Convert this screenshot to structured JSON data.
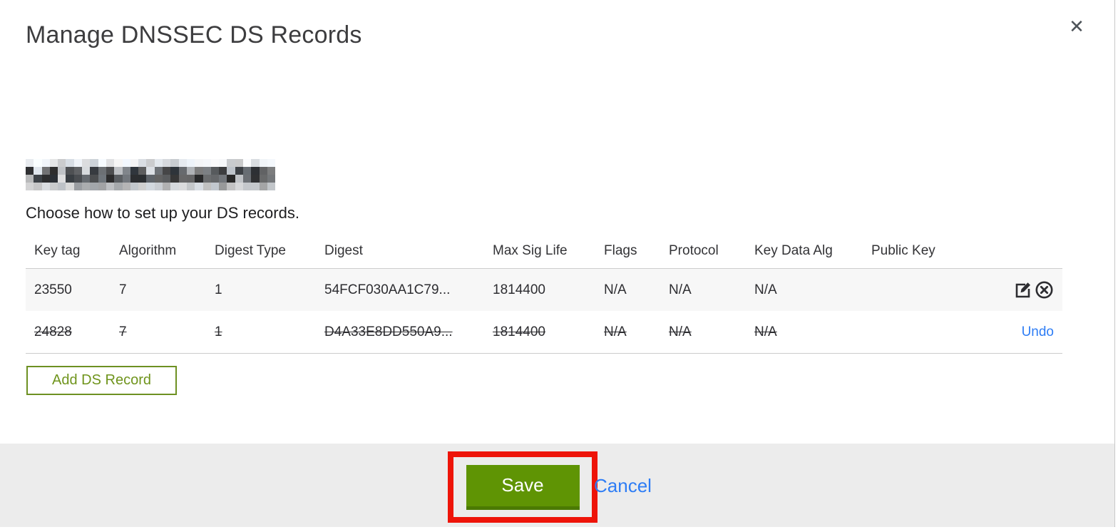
{
  "modal": {
    "title": "Manage DNSSEC DS Records",
    "close_glyph": "✕",
    "instruction": "Choose how to set up your DS records."
  },
  "table": {
    "headers": [
      "Key tag",
      "Algorithm",
      "Digest Type",
      "Digest",
      "Max Sig Life",
      "Flags",
      "Protocol",
      "Key Data Alg",
      "Public Key"
    ],
    "rows": [
      {
        "key_tag": "23550",
        "algorithm": "7",
        "digest_type": "1",
        "digest": "54FCF030AA1C79...",
        "max_sig_life": "1814400",
        "flags": "N/A",
        "protocol": "N/A",
        "key_data_alg": "N/A",
        "public_key": "",
        "state": "active"
      },
      {
        "key_tag": "24828",
        "algorithm": "7",
        "digest_type": "1",
        "digest": "D4A33E8DD550A9...",
        "max_sig_life": "1814400",
        "flags": "N/A",
        "protocol": "N/A",
        "key_data_alg": "N/A",
        "public_key": "",
        "state": "marked-for-deletion",
        "undo_label": "Undo"
      }
    ]
  },
  "buttons": {
    "add_ds_record": "Add DS Record",
    "save": "Save",
    "cancel": "Cancel"
  },
  "colors": {
    "primary_green": "#5f9404",
    "green_border": "#6d9022",
    "link_blue": "#2e7df5",
    "annotation_red": "#ee1409",
    "footer_bg": "#ececec",
    "row_alt_bg": "#f7f7f7"
  }
}
